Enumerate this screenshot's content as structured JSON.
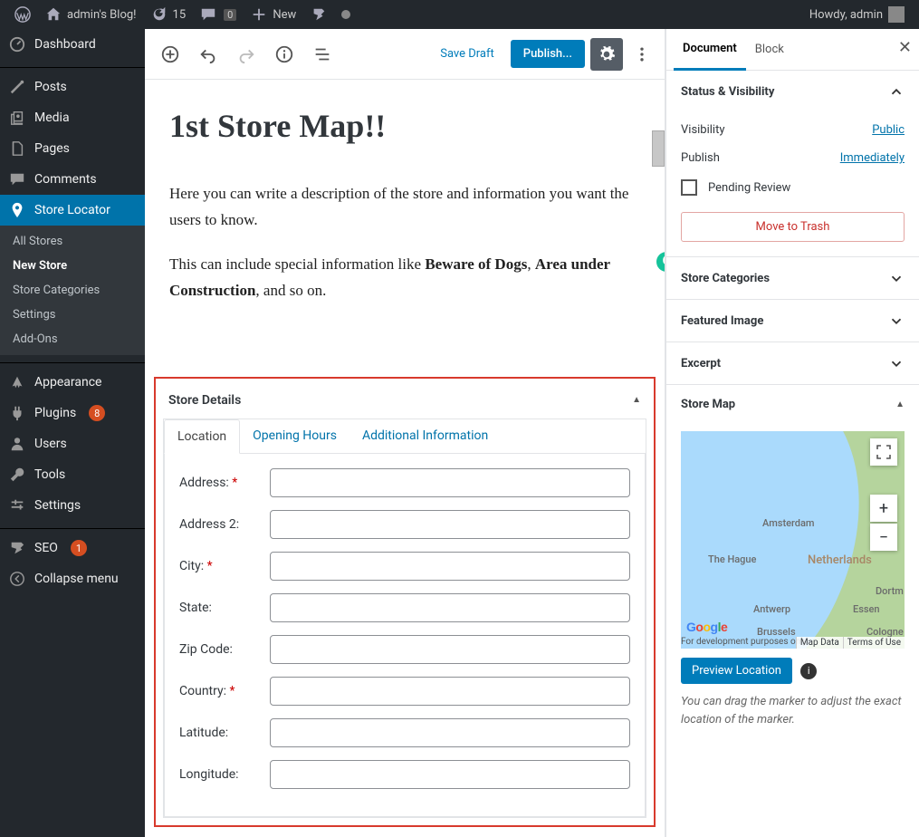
{
  "adminbar": {
    "site_name": "admin's Blog!",
    "refresh_count": "15",
    "comments_count": "0",
    "new_label": "New",
    "greeting": "Howdy, admin"
  },
  "menu": {
    "dashboard": "Dashboard",
    "posts": "Posts",
    "media": "Media",
    "pages": "Pages",
    "comments": "Comments",
    "store_locator": "Store Locator",
    "sub": {
      "all_stores": "All Stores",
      "new_store": "New Store",
      "store_categories": "Store Categories",
      "settings": "Settings",
      "addons": "Add-Ons"
    },
    "appearance": "Appearance",
    "plugins": "Plugins",
    "plugins_badge": "8",
    "users": "Users",
    "tools": "Tools",
    "wp_settings": "Settings",
    "seo": "SEO",
    "seo_badge": "1",
    "collapse": "Collapse menu"
  },
  "toolbar": {
    "save_draft": "Save Draft",
    "publish": "Publish..."
  },
  "post": {
    "title": "1st Store Map!!",
    "para1": "Here you can write a description of the store and information you want the users to know.",
    "para2_a": "This can include special information like ",
    "para2_b": "Beware of Dogs",
    "para2_c": ", ",
    "para2_d": "Area under Construction",
    "para2_e": ", and so on."
  },
  "metabox": {
    "title": "Store Details",
    "tabs": {
      "location": "Location",
      "hours": "Opening Hours",
      "additional": "Additional Information"
    },
    "fields": {
      "address": "Address:",
      "address2": "Address 2:",
      "city": "City:",
      "state": "State:",
      "zip": "Zip Code:",
      "country": "Country:",
      "lat": "Latitude:",
      "lon": "Longitude:"
    }
  },
  "doc_tabs": {
    "document": "Document",
    "block": "Block"
  },
  "status_panel": {
    "title": "Status & Visibility",
    "visibility_label": "Visibility",
    "visibility_value": "Public",
    "publish_label": "Publish",
    "publish_value": "Immediately",
    "pending": "Pending Review",
    "trash": "Move to Trash"
  },
  "panels": {
    "store_categories": "Store Categories",
    "featured_image": "Featured Image",
    "excerpt": "Excerpt",
    "store_map": "Store Map"
  },
  "map": {
    "cities": {
      "amsterdam": "Amsterdam",
      "hague": "The Hague",
      "antwerp": "Antwerp",
      "brussels": "Brussels",
      "dortmund": "Dortm",
      "essen": "Essen",
      "cologne": "Cologne"
    },
    "country": "Netherlands",
    "mapdata": "Map Data",
    "terms": "Terms of Use",
    "dev_warning": "For development purposes only",
    "preview": "Preview Location",
    "hint": "You can drag the marker to adjust the exact location of the marker."
  }
}
